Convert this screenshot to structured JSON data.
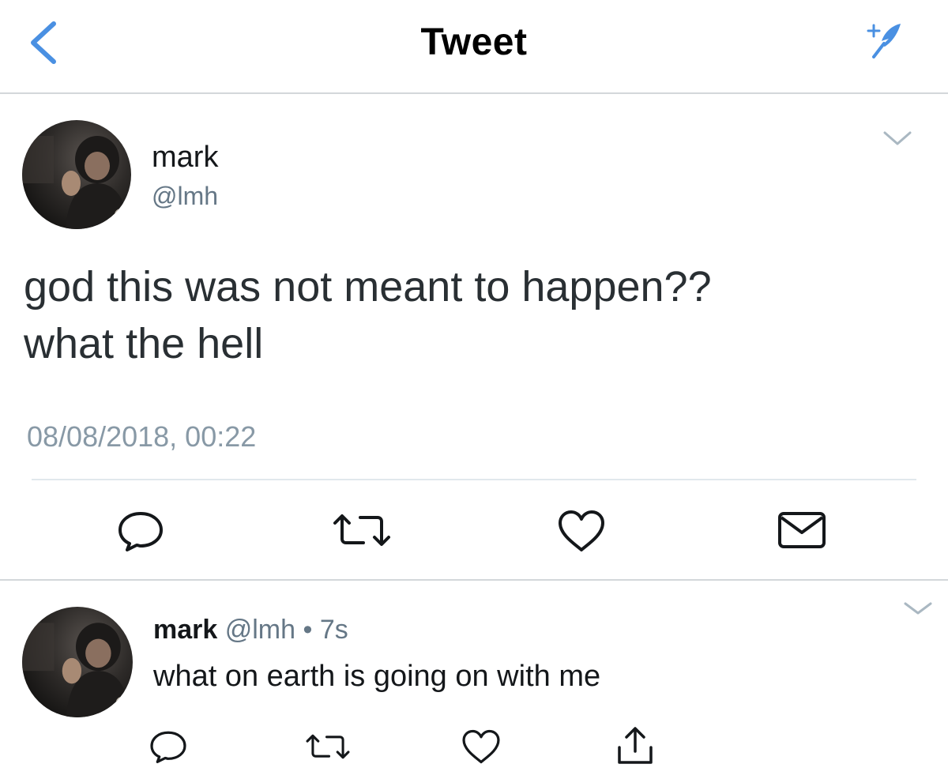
{
  "header": {
    "title": "Tweet",
    "back_icon": "chevron-left-icon",
    "compose_icon": "compose-feather-icon",
    "accent_color": "#4a90e2"
  },
  "main_tweet": {
    "author_name": "mark",
    "author_handle": "@lmh",
    "text_line_1": "god this was not meant to happen??",
    "text_line_2": "what the hell",
    "timestamp": "08/08/2018, 00:22",
    "action_icons": [
      "reply-icon",
      "retweet-icon",
      "heart-icon",
      "envelope-icon"
    ]
  },
  "reply_tweet": {
    "author_name": "mark",
    "meta": " @lmh • 7s",
    "text": "what on earth is going on with me",
    "action_icons": [
      "reply-icon",
      "retweet-icon",
      "heart-icon",
      "share-icon"
    ]
  },
  "colors": {
    "secondary_text": "#657786",
    "timestamp_text": "#8899a6",
    "divider": "#d3d7da",
    "icon": "#657786"
  }
}
